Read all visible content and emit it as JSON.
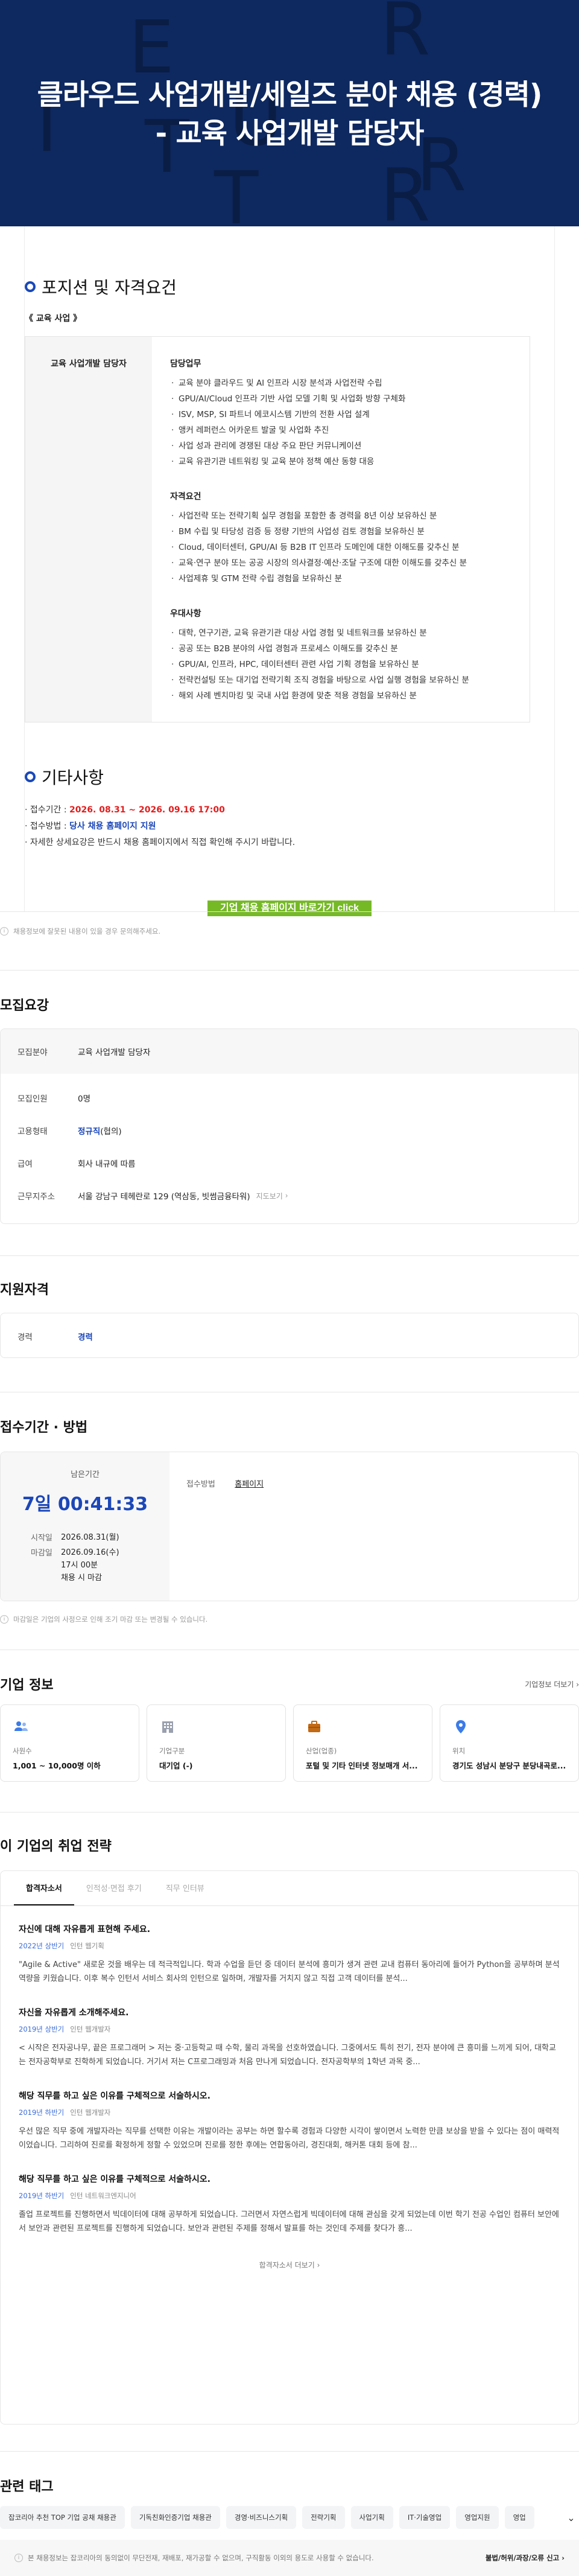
{
  "hero": {
    "title_line1": "클라우드 사업개발/세일즈 분야 채용 (경력)",
    "title_line2": "- 교육 사업개발 담당자",
    "letters": [
      "E",
      "R",
      "I",
      "T",
      "U",
      "R",
      "T",
      "R"
    ]
  },
  "position": {
    "section_title": "포지션 및 자격요건",
    "group_label": "《 교육 사업 》",
    "role_name": "교육 사업개발 담당자",
    "groups": [
      {
        "title": "담당업무",
        "items": [
          "교육 분야 클라우드 및 AI 인프라 시장 분석과 사업전략 수립",
          "GPU/AI/Cloud 인프라 기반 사업 모델 기획 및 사업화 방향 구체화",
          "ISV, MSP, SI 파트너 에코시스템 기반의 전환 사업 설계",
          "앵커 레퍼런스 어카운트 발굴 및 사업화 추진",
          "사업 성과 관리에 경쟁된 대상 주요 판단 커뮤니케이션",
          "교육 유관기관 네트워킹 및 교육 분야 정책 예산 동향 대응"
        ]
      },
      {
        "title": "자격요건",
        "items": [
          "사업전략 또는 전략기획 실무 경험을 포함한 총 경력을 8년 이상 보유하신 분",
          "BM 수립 및 타당성 검증 등 정량 기반의 사업성 검토 경험을 보유하신 분",
          "Cloud, 데이터센터, GPU/AI 등 B2B IT 인프라 도메인에 대한 이해도를 갖추신 분",
          "교육·연구 분야 또는 공공 시장의 의사결정·예산·조달 구조에 대한 이해도를 갖추신 분",
          "사업제휴 및 GTM 전략 수립 경험을 보유하신 분"
        ]
      },
      {
        "title": "우대사항",
        "items": [
          "대학, 연구기관, 교육 유관기관 대상 사업 경험 및 네트워크를 보유하신 분",
          "공공 또는 B2B 분야의 사업 경험과 프로세스 이해도를 갖추신 분",
          "GPU/AI, 인프라, HPC, 데이터센터 관련 사업 기획 경험을 보유하신 분",
          "전략컨설팅 또는 대기업 전략기획 조직 경험을 바탕으로 사업 실행 경험을 보유하신 분",
          "해외 사례 벤치마킹 및 국내 사업 환경에 맞춘 적용 경험을 보유하신 분"
        ]
      }
    ]
  },
  "etc": {
    "section_title": "기타사항",
    "period_label": "접수기간 : ",
    "period_value": "2026. 08.31 ~ 2026. 09.16  17:00",
    "method_label": "접수방법 : ",
    "method_value": "당사 채용 홈페이지 지원",
    "detail": "자세한 상세요강은 반드시 채용 홈페이지에서 직접 확인해 주시기 바랍니다.",
    "apply_button": "기업 채용 홈페이지 바로가기 click"
  },
  "notice1": "채용정보에 잘못된 내용이 있을 경우 문의해주세요.",
  "recruit": {
    "title": "모집요강",
    "rows": [
      {
        "k": "모집분야",
        "v": "교육 사업개발 담당자"
      },
      {
        "k": "모집인원",
        "v": "0명"
      },
      {
        "k": "고용형태",
        "v_strong": "정규직",
        "v": "(협의)"
      },
      {
        "k": "급여",
        "v": "회사 내규에 따름"
      },
      {
        "k": "근무지주소",
        "v": "서울 강남구 테헤란로 129 (역삼동, 빗썸금융타워)",
        "map": "지도보기"
      }
    ]
  },
  "qual": {
    "title": "지원자격",
    "k": "경력",
    "v": "경력"
  },
  "deadline": {
    "title": "접수기간 · 방법",
    "remain_label": "남은기간",
    "remain": "7일 00:41:33",
    "start_label": "시작일",
    "start": "2026.08.31(월)",
    "end_label": "마감일",
    "end_line1": "2026.09.16(수)",
    "end_line2": "17시 00분",
    "end_line3": "채용 시 마감",
    "method_label": "접수방법",
    "method_value": "홈페이지",
    "notice": "마감일은 기업의 사정으로 인해 조기 마감 또는 변경될 수 있습니다."
  },
  "company": {
    "title": "기업 정보",
    "more": "기업정보 더보기",
    "cards": [
      {
        "icon": "people-icon",
        "label": "사원수",
        "value": "1,001 ~ 10,000명 이하"
      },
      {
        "icon": "building-icon",
        "label": "기업구분",
        "value": "대기업 (-)"
      },
      {
        "icon": "briefcase-icon",
        "label": "산업(업종)",
        "value": "포털 및 기타 인터넷 정보매개 서..."
      },
      {
        "icon": "location-icon",
        "label": "위치",
        "value": "경기도 성남시 분당구 분당내곡로..."
      }
    ]
  },
  "strategy": {
    "title": "이 기업의 취업 전략",
    "tabs": [
      "합격자소서",
      "인적성·면접 후기",
      "직무 인터뷰"
    ],
    "entries": [
      {
        "q": "자신에 대해 자유롭게 표현해 주세요.",
        "year": "2022년 상반기",
        "dept": "인턴   웹기획",
        "body": "\"Agile & Active\" 새로운 것을 배우는 데 적극적입니다. 학과 수업을 듣던 중 데이터 분석에 흥미가 생겨 관련 교내 컴퓨터 동아리에 들어가 Python을 공부하며 분석 역량을 키웠습니다. 이후 복수 인턴서 서비스 회사의 인턴으로 일하며, 개발자를 거치지 않고 직접 고객 데이터를 분석..."
      },
      {
        "q": "자신을 자유롭게 소개해주세요.",
        "year": "2019년 상반기",
        "dept": "인턴   웹개발자",
        "body": "< 시작은 전자공나무, 끝은 프로그래머 > 저는 중·고등학교 때 수학, 물리 과목을 선호하였습니다. 그중에서도 특히 전기, 전자 분야에 큰 흥미를 느끼게 되어, 대학교는 전자공학부로 진학하게 되었습니다. 거기서 저는 C프로그래밍과 처음 만나게 되었습니다. 전자공학부의 1학년 과목 중..."
      },
      {
        "q": "해당 직무를 하고 싶은 이유를 구체적으로 서술하시오.",
        "year": "2019년 하반기",
        "dept": "인턴   웹개발자",
        "body": "우선 많은 직무 중에 개발자라는 직무를 선택한 이유는 개발이라는 공부는 하면 할수록 경험과 다양한 시각이 쌓이면서 노력한 만큼 보상을 받을 수 있다는 점이 매력적이었습니다. 그리하여 진로를 확정하게 정할 수 있었으며 진로를 정한 후에는 연합동아리, 경진대회, 해커톤 대회 등에 참..."
      },
      {
        "q": "해당 직무를 하고 싶은 이유를 구체적으로 서술하시오.",
        "year": "2019년 하반기",
        "dept": "인턴   네트워크엔지니어",
        "body": "졸업 프로젝트를 진행하면서 빅데이터에 대해 공부하게 되었습니다. 그러면서 자연스럽게 빅데이터에 대해 관심을 갖게 되었는데 이번 학기 전공 수업인 컴퓨터 보안에서 보안과 관련된 프로젝트를 진행하게 되었습니다. 보안과 관련된 주제를 정해서 발표를 하는 것인데 주제를 찾다가 흥..."
      }
    ],
    "more": "합격자소서 더보기"
  },
  "tags": {
    "title": "관련 태그",
    "items": [
      "잡코리아 추천 TOP 기업 공채 채용관",
      "기독친화인증기업 채용관",
      "경영·비즈니스기획",
      "전략기획",
      "사업기획",
      "IT·기술영업",
      "영업지원",
      "영업"
    ]
  },
  "footer": {
    "left": "본 채용정보는 잡코리아의 동의없이 무단전재, 재배포, 재가공할 수 없으며, 구직활동 이외의 용도로 사용할 수 없습니다.",
    "right": "불법/허위/과장/오류 신고"
  },
  "colors": {
    "hero_bg": "#0e2960",
    "accent_blue": "#1c47b8",
    "red": "#e11d1d",
    "green_btn": "#76b927"
  }
}
